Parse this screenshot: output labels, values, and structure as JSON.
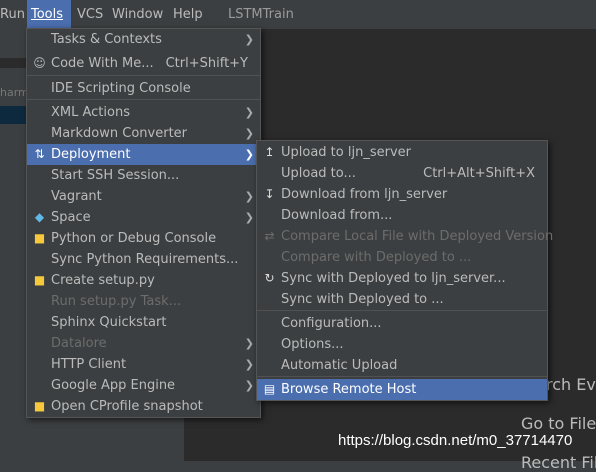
{
  "menubar": {
    "run": "Run",
    "tools": "Tools",
    "vcs": "VCS",
    "window": "Window",
    "help": "Help",
    "project_title": "LSTMTrain"
  },
  "background": {
    "left_fragment": "harm",
    "search_hint": "rch Eve",
    "goto_hint": "Go to File",
    "recent_hint": "Recent Fil",
    "watermark": "https://blog.csdn.net/m0_37714470"
  },
  "tools_menu": [
    {
      "label": "Tasks & Contexts",
      "submenu": true
    },
    {
      "label": "Code With Me...",
      "shortcut": "Ctrl+Shift+Y",
      "icon": "user-icon"
    },
    {
      "label": "IDE Scripting Console"
    },
    {
      "label": "XML Actions",
      "submenu": true
    },
    {
      "label": "Markdown Converter",
      "submenu": true
    },
    {
      "label": "Deployment",
      "submenu": true,
      "selected": true,
      "icon": "deployment-icon"
    },
    {
      "label": "Start SSH Session..."
    },
    {
      "label": "Vagrant",
      "submenu": true
    },
    {
      "label": "Space",
      "submenu": true,
      "icon": "space-icon"
    },
    {
      "label": "Python or Debug Console",
      "icon": "python-icon"
    },
    {
      "label": "Sync Python Requirements..."
    },
    {
      "label": "Create setup.py",
      "icon": "python-icon"
    },
    {
      "label": "Run setup.py Task...",
      "disabled": true
    },
    {
      "label": "Sphinx Quickstart"
    },
    {
      "label": "Datalore",
      "submenu": true,
      "disabled": true
    },
    {
      "label": "HTTP Client",
      "submenu": true
    },
    {
      "label": "Google App Engine",
      "submenu": true
    },
    {
      "label": "Open CProfile snapshot",
      "icon": "python-icon"
    }
  ],
  "deployment_menu": [
    {
      "label": "Upload to ljn_server",
      "icon": "upload-icon"
    },
    {
      "label": "Upload to...",
      "shortcut": "Ctrl+Alt+Shift+X"
    },
    {
      "label": "Download from ljn_server",
      "icon": "download-icon"
    },
    {
      "label": "Download from..."
    },
    {
      "label": "Compare Local File with Deployed Version",
      "disabled": true,
      "icon": "compare-icon"
    },
    {
      "label": "Compare with Deployed to ...",
      "disabled": true
    },
    {
      "label": "Sync with Deployed to ljn_server...",
      "icon": "sync-icon"
    },
    {
      "label": "Sync with Deployed to ..."
    },
    {
      "label": "Configuration..."
    },
    {
      "label": "Options..."
    },
    {
      "label": "Automatic Upload"
    },
    {
      "label": "Browse Remote Host",
      "selected": true,
      "icon": "browse-remote-icon"
    }
  ]
}
